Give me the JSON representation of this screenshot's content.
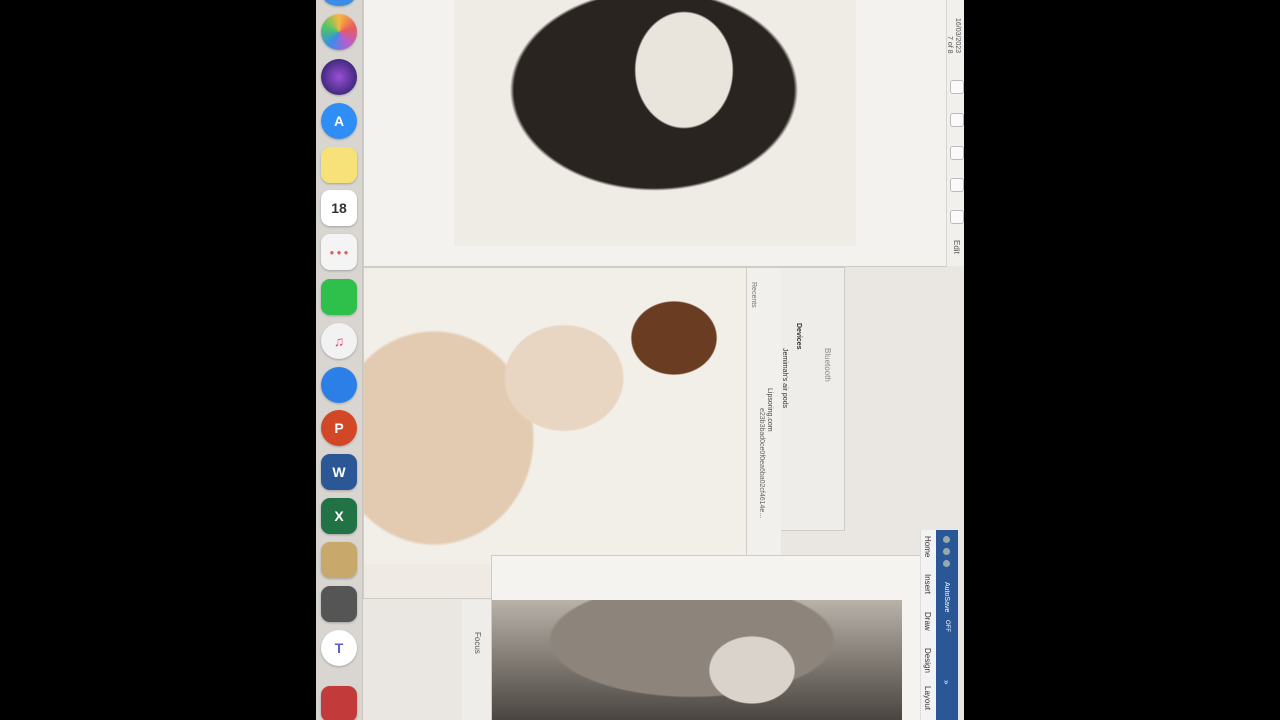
{
  "dock": {
    "items": [
      {
        "icon": "photos-icon",
        "label": ""
      },
      {
        "icon": "siri-icon",
        "label": ""
      },
      {
        "icon": "app-store-icon",
        "label": "A"
      },
      {
        "icon": "notes-icon",
        "label": ""
      },
      {
        "icon": "calendar-icon",
        "label": "18"
      },
      {
        "icon": "reminders-icon",
        "label": ""
      },
      {
        "icon": "facetime-icon",
        "label": ""
      },
      {
        "icon": "itunes-icon",
        "label": "♫"
      },
      {
        "icon": "messenger-icon",
        "label": ""
      },
      {
        "icon": "powerpoint-icon",
        "label": "P"
      },
      {
        "icon": "word-icon",
        "label": "W"
      },
      {
        "icon": "excel-icon",
        "label": "X"
      },
      {
        "icon": "archive-icon",
        "label": ""
      },
      {
        "icon": "books-icon",
        "label": ""
      },
      {
        "icon": "teams-icon",
        "label": "T"
      },
      {
        "icon": "photo-booth-icon",
        "label": ""
      }
    ],
    "colors": {
      "photos": "#f5b942",
      "siri": "#3a2b8c",
      "appstore": "#2f8ef5",
      "notes": "#f7e27a",
      "calendar": "#ffffff",
      "reminders": "#f4f4f4",
      "facetime": "#2fbf4b",
      "itunes": "#f2f2f2",
      "messenger": "#2d7fe8",
      "powerpoint": "#d24726",
      "word": "#2b5797",
      "excel": "#217346",
      "archive": "#c9a96b",
      "books": "#555555",
      "teams": "#ffffff",
      "photobooth": "#c23a3a"
    }
  },
  "preview_window": {
    "date": "16/03/2023",
    "page_count": "7 of 8",
    "edit_label": "Edit"
  },
  "bluetooth_window": {
    "title": "Bluetooth",
    "section": "Devices",
    "device": "Jemimah's air pods",
    "sidebar_items": [
      "Recents",
      "Lipsoring.com"
    ],
    "file_label": "e23b3bad0ce0f0ea6ba02cf4614e..."
  },
  "word_window": {
    "autosave_label": "AutoSave",
    "autosave_state": "OFF",
    "tabs": [
      "Home",
      "Insert",
      "Draw",
      "Design",
      "Layout"
    ],
    "focus_label": "Focus"
  }
}
